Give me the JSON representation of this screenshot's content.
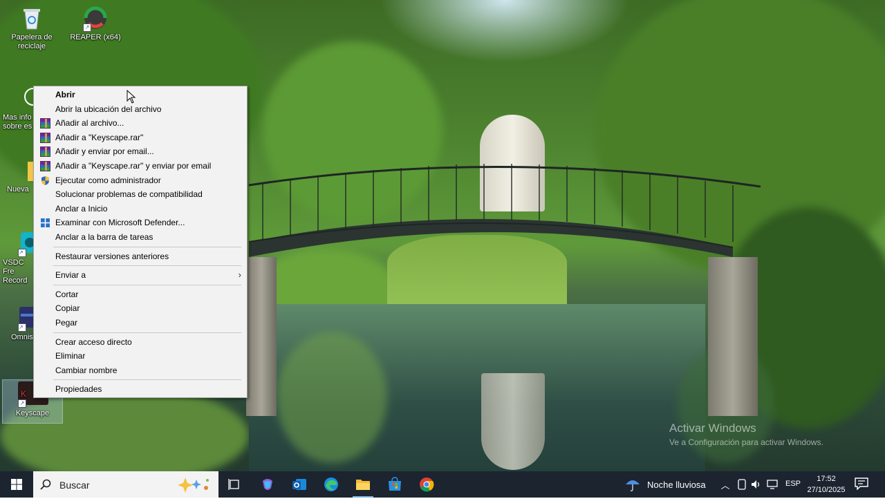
{
  "desktop_icons": [
    {
      "label": "Papelera de reciclaje",
      "icon": "recycle-bin-icon"
    },
    {
      "label": "REAPER (x64)",
      "icon": "reaper-icon"
    },
    {
      "label": "Mas info sobre es",
      "icon": "info-icon"
    },
    {
      "label": "Nueva",
      "icon": "folder-icon"
    },
    {
      "label": "VSDC Fre Record",
      "icon": "vsdc-icon"
    },
    {
      "label": "Omnis",
      "icon": "omnis-icon"
    },
    {
      "label": "Keyscape",
      "icon": "keyscape-icon"
    }
  ],
  "context_menu": {
    "open": "Abrir",
    "open_location": "Abrir la ubicación del archivo",
    "add_archive": "Añadir al archivo...",
    "add_rar": "Añadir a \"Keyscape.rar\"",
    "add_email": "Añadir y enviar por email...",
    "add_rar_email": "Añadir a \"Keyscape.rar\" y enviar por email",
    "run_admin": "Ejecutar como administrador",
    "troubleshoot": "Solucionar problemas de compatibilidad",
    "pin_start": "Anclar a Inicio",
    "defender": "Examinar con Microsoft Defender...",
    "pin_taskbar": "Anclar a la barra de tareas",
    "restore": "Restaurar versiones anteriores",
    "send_to": "Enviar a",
    "cut": "Cortar",
    "copy": "Copiar",
    "paste": "Pegar",
    "shortcut": "Crear acceso directo",
    "delete": "Eliminar",
    "rename": "Cambiar nombre",
    "properties": "Propiedades"
  },
  "watermark": {
    "title": "Activar Windows",
    "subtitle": "Ve a Configuración para activar Windows."
  },
  "taskbar": {
    "search_placeholder": "Buscar",
    "apps": [
      "task-view-icon",
      "copilot-icon",
      "outlook-icon",
      "edge-icon",
      "file-explorer-icon",
      "store-icon",
      "chrome-icon"
    ],
    "weather": "Noche lluviosa",
    "language": "ESP",
    "time": "17:52",
    "date": "27/10/2025"
  }
}
